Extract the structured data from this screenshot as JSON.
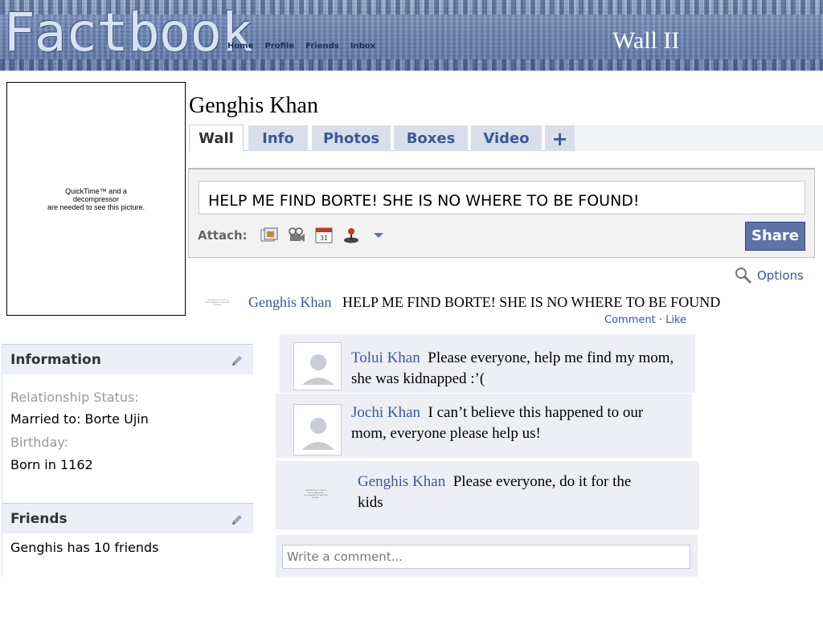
{
  "header": {
    "logo": "Factbook",
    "nav": [
      "Home",
      "Profile",
      "Friends",
      "Inbox"
    ],
    "slide_title": "Wall II"
  },
  "profile": {
    "picture_placeholder": [
      "QuickTime™ and a",
      "decompressor",
      "are needed to see this picture."
    ],
    "name": "Genghis Khan"
  },
  "tabs": [
    "Wall",
    "Info",
    "Photos",
    "Boxes",
    "Video",
    "+"
  ],
  "composer": {
    "status_text": "HELP ME FIND BORTE! SHE IS NO WHERE TO BE FOUND!",
    "attach_label": "Attach:",
    "attach_icons": [
      "photo-icon",
      "video-icon",
      "event-icon",
      "game-icon",
      "more-dropdown-icon"
    ],
    "share_label": "Share"
  },
  "options_label": "Options",
  "post": {
    "author": "Genghis Khan",
    "text": "HELP ME FIND BORTE! SHE IS NO WHERE TO BE FOUND",
    "actions": {
      "comment": "Comment",
      "separator": "·",
      "like": "Like"
    }
  },
  "comments": [
    {
      "author": "Tolui Khan",
      "text": "Please everyone, help me find my mom, she was kidnapped :’("
    },
    {
      "author": "Jochi Khan",
      "text": "I can’t believe this happened to our mom, everyone please help us!"
    },
    {
      "author": "Genghis Khan",
      "text": "Please everyone, do it for the kids"
    }
  ],
  "write_comment_placeholder": "Write a comment...",
  "information": {
    "title": "Information",
    "relationship_label": "Relationship Status:",
    "relationship_value": "Married to: Borte Ujin",
    "birthday_label": "Birthday:",
    "birthday_value": "Born in 1162"
  },
  "friends": {
    "title": "Friends",
    "summary": "Genghis has 10 friends"
  },
  "colors": {
    "link_blue": "#3b5998",
    "tab_bg": "#d8dfea",
    "share_button": "#5b74a8",
    "comment_bg": "#edeff4"
  }
}
